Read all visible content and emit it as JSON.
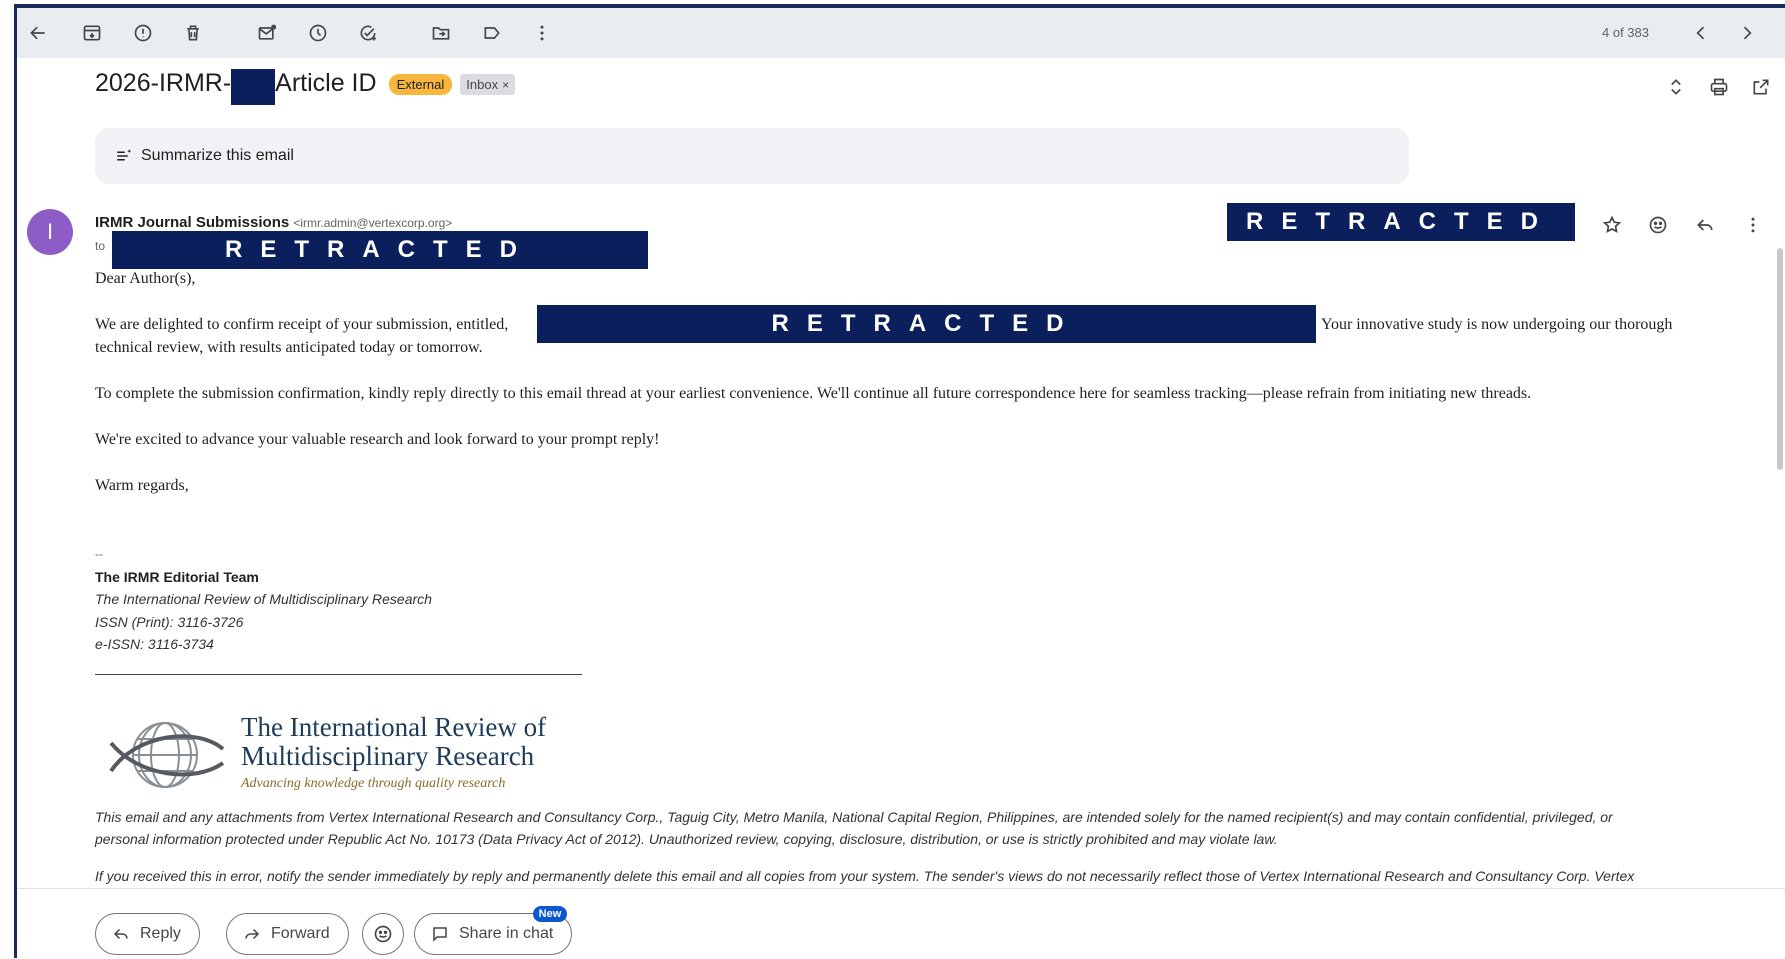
{
  "toolbar": {
    "pager": "4 of 383",
    "icons": [
      "back-arrow-icon",
      "archive-icon",
      "report-spam-icon",
      "delete-icon",
      "mark-unread-icon",
      "snooze-icon",
      "add-task-icon",
      "move-to-icon",
      "label-icon",
      "more-vert-icon",
      "prev-icon",
      "next-icon"
    ]
  },
  "subject": {
    "prefix": "2026-IRMR-",
    "suffix": "Article ID",
    "badge_external": "External",
    "badge_inbox": "Inbox",
    "badge_inbox_close": "×"
  },
  "summarize": {
    "label": "Summarize this email"
  },
  "sender": {
    "avatar_letter": "I",
    "name": "IRMR Journal Submissions",
    "email": "<irmr.admin@vertexcorp.org>",
    "to_label": "to",
    "redacted": "RETRACTED"
  },
  "body": {
    "greeting": "Dear Author(s),",
    "p1_start": "We are delighted to confirm receipt of your submission, entitled, ",
    "p1_end": " Your innovative study is now undergoing our thorough",
    "p1_line2": "technical review, with results anticipated today or tomorrow.",
    "p2": "To complete the submission confirmation, kindly reply directly to this email thread at your earliest convenience. We'll continue all future correspondence here for seamless tracking—please refrain from initiating new threads.",
    "p3": "We're excited to advance your valuable research and look forward to your prompt reply!",
    "closing": "Warm regards,",
    "dashes": "--"
  },
  "signature": {
    "team": "The IRMR Editorial Team",
    "journal": "The International Review of Multidisciplinary Research",
    "issn_print": "ISSN (Print): 3116-3726",
    "issn_e": "e-ISSN: 3116-3734"
  },
  "logo": {
    "title_line1": "The International Review of",
    "title_line2": "Multidisciplinary Research",
    "tagline": "Advancing knowledge through quality research"
  },
  "disclaimer": {
    "line1": "This email and any attachments from Vertex International Research and Consultancy Corp., Taguig City, Metro Manila, National Capital Region, Philippines, are intended solely for the named recipient(s) and may contain confidential, privileged, or",
    "line2": "personal information protected under Republic Act No. 10173 (Data Privacy Act of 2012). Unauthorized review, copying, disclosure, distribution, or use is strictly prohibited and may violate law.",
    "line3": "If you received this in error, notify the sender immediately by reply and permanently delete this email and all copies from your system. The sender's views do not necessarily reflect those of Vertex International Research and Consultancy Corp. Vertex"
  },
  "actions": {
    "reply": "Reply",
    "forward": "Forward",
    "share": "Share in chat",
    "new_badge": "New"
  },
  "colors": {
    "redaction": "#0a1f5c",
    "avatar": "#8e5cc7",
    "external_badge": "#f6b73c",
    "new_badge": "#0b57d0"
  }
}
